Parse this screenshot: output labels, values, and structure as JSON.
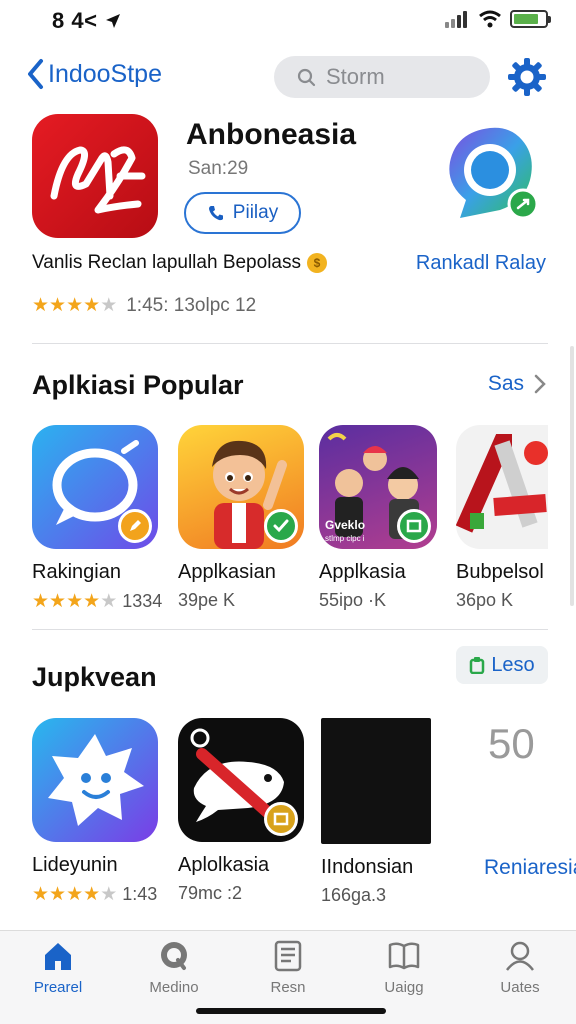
{
  "status_bar": {
    "time": "8 4<"
  },
  "nav": {
    "back_label": "IndooStpe",
    "search_placeholder": "Storm"
  },
  "featured": {
    "title": "Anboneasia",
    "subtitle": "San:29",
    "play_label": "Piilay",
    "description": "Vanlis Reclan lapullah Bepolass",
    "link": "Rankadl Ralay",
    "rating_value": 4.5,
    "rating_text": "1:45: 13olpc 12"
  },
  "sections": [
    {
      "title": "Aplkiasi Popular",
      "action": "Sas",
      "apps": [
        {
          "name": "Rakingian",
          "meta": "1334",
          "rating_value": 4.5
        },
        {
          "name": "Applkasian",
          "meta": "39pe K"
        },
        {
          "name": "Applkasia",
          "meta": "55ipo ·K"
        },
        {
          "name": "Bubpelsol",
          "meta": "36po K"
        }
      ]
    },
    {
      "title": "Jupkvean",
      "action": "Leso",
      "apps": [
        {
          "name": "Lideyunin",
          "meta": "1:43",
          "rating_value": 4.5
        },
        {
          "name": "Aplolkasia",
          "meta": "79mc :2"
        },
        {
          "name": "IIndonsian",
          "meta": "166ga.3"
        }
      ],
      "side_number": "50",
      "side_link": "Reniaresia"
    }
  ],
  "app_tile_text": {
    "game_caption": "Gveklo",
    "game_caption_sub": "stlmp clpc i"
  },
  "tabs": [
    {
      "label": "Prearel",
      "icon": "home-icon",
      "active": true
    },
    {
      "label": "Medino",
      "icon": "search-magnifier-icon",
      "active": false
    },
    {
      "label": "Resn",
      "icon": "document-icon",
      "active": false
    },
    {
      "label": "Uaigg",
      "icon": "book-icon",
      "active": false
    },
    {
      "label": "Uates",
      "icon": "person-icon",
      "active": false
    }
  ],
  "colors": {
    "accent": "#1a63c8",
    "star": "#f3a51b",
    "featured_icon": "#d7141c"
  }
}
